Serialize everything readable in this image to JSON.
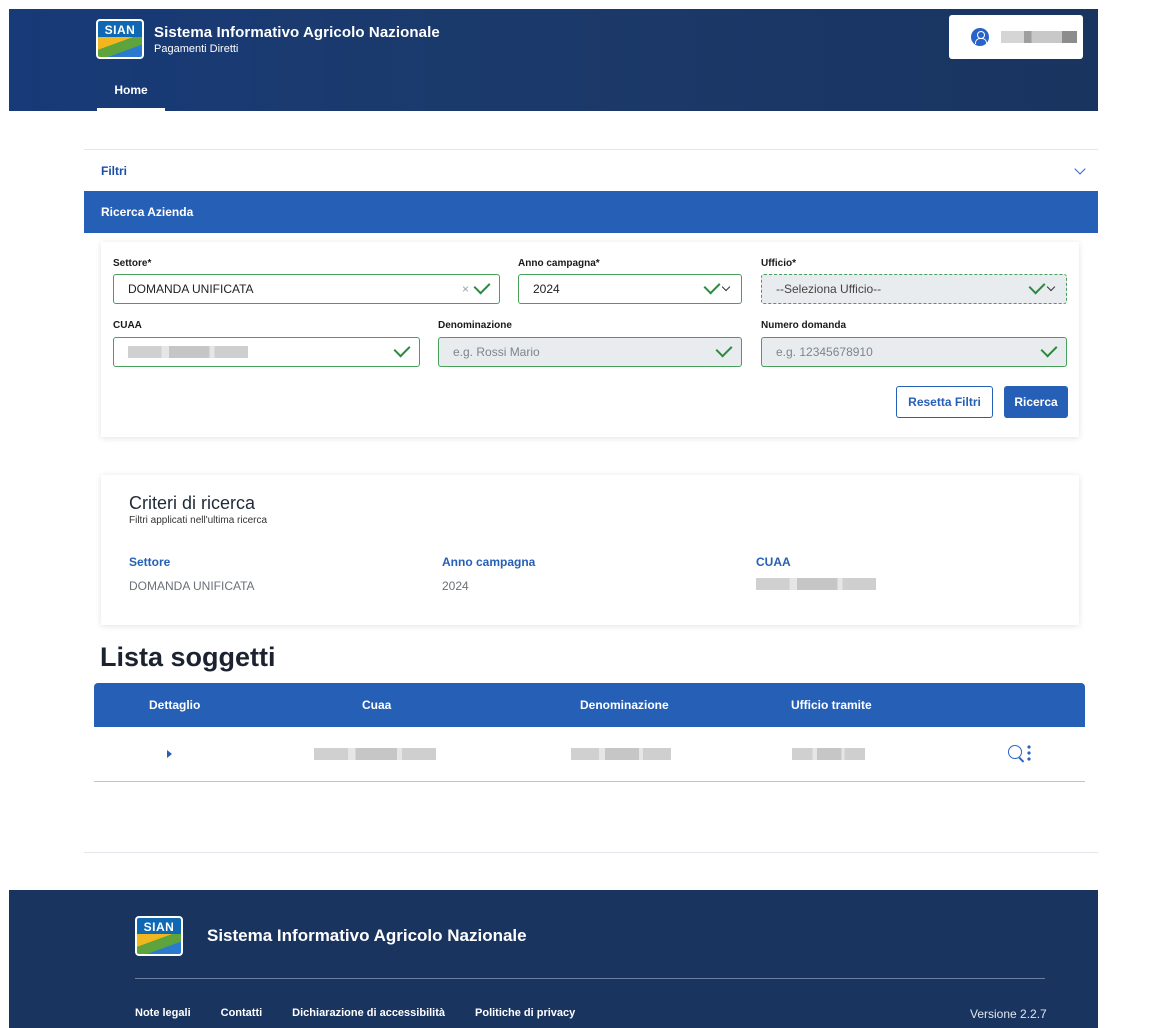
{
  "header": {
    "logo_text": "SIAN",
    "title": "Sistema Informativo Agricolo Nazionale",
    "subtitle": "Pagamenti Diretti",
    "nav": {
      "home_label": "Home"
    },
    "user": {
      "icon": "user-icon"
    }
  },
  "filters": {
    "toggle_label": "Filtri",
    "section_title": "Ricerca Azienda",
    "settore": {
      "label": "Settore*",
      "value": "DOMANDA UNIFICATA",
      "clear": "×"
    },
    "anno": {
      "label": "Anno campagna*",
      "value": "2024"
    },
    "ufficio": {
      "label": "Ufficio*",
      "value": "--Seleziona Ufficio--"
    },
    "cuaa": {
      "label": "CUAA"
    },
    "denominazione": {
      "label": "Denominazione",
      "placeholder": "e.g. Rossi Mario"
    },
    "numero_domanda": {
      "label": "Numero domanda",
      "placeholder": "e.g. 12345678910"
    },
    "reset_label": "Resetta Filtri",
    "search_label": "Ricerca"
  },
  "criteri": {
    "title": "Criteri di ricerca",
    "subtitle": "Filtri applicati nell'ultima ricerca",
    "settore_label": "Settore",
    "settore_value": "DOMANDA UNIFICATA",
    "anno_label": "Anno campagna",
    "anno_value": "2024",
    "cuaa_label": "CUAA"
  },
  "lista": {
    "title": "Lista soggetti",
    "columns": [
      "Dettaglio",
      "Cuaa",
      "Denominazione",
      "Ufficio tramite"
    ]
  },
  "footer": {
    "logo_text": "SIAN",
    "title": "Sistema Informativo Agricolo Nazionale",
    "links": [
      "Note legali",
      "Contatti",
      "Dichiarazione di accessibilità",
      "Politiche di privacy"
    ],
    "version": "Versione 2.2.7"
  },
  "colors": {
    "primary": "#2660b6",
    "header_bg": "#1b3a6c",
    "success": "#2b8a3e"
  }
}
